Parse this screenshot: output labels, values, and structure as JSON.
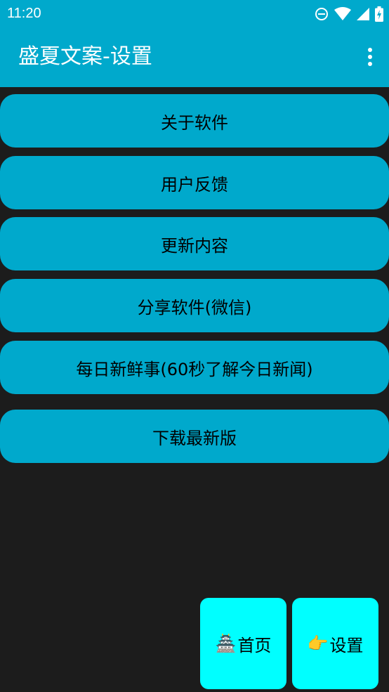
{
  "status_bar": {
    "time": "11:20",
    "icons": [
      "do-not-disturb-icon",
      "wifi-icon",
      "cell-signal-icon",
      "battery-charging-icon"
    ]
  },
  "app_bar": {
    "title": "盛夏文案-设置",
    "menu_icon": "more-vertical-icon"
  },
  "menu": {
    "items": [
      {
        "label": "关于软件"
      },
      {
        "label": "用户反馈"
      },
      {
        "label": "更新内容"
      },
      {
        "label": "分享软件(微信)"
      },
      {
        "label": "每日新鲜事(60秒了解今日新闻)"
      },
      {
        "label": "下载最新版"
      }
    ]
  },
  "bottom_nav": {
    "home": {
      "emoji": "🏯",
      "label": "首页"
    },
    "settings": {
      "emoji": "👉",
      "label": "设置"
    }
  },
  "colors": {
    "accent": "#00a9cc",
    "nav_button": "#00ffff",
    "background": "#1c1c1c"
  }
}
